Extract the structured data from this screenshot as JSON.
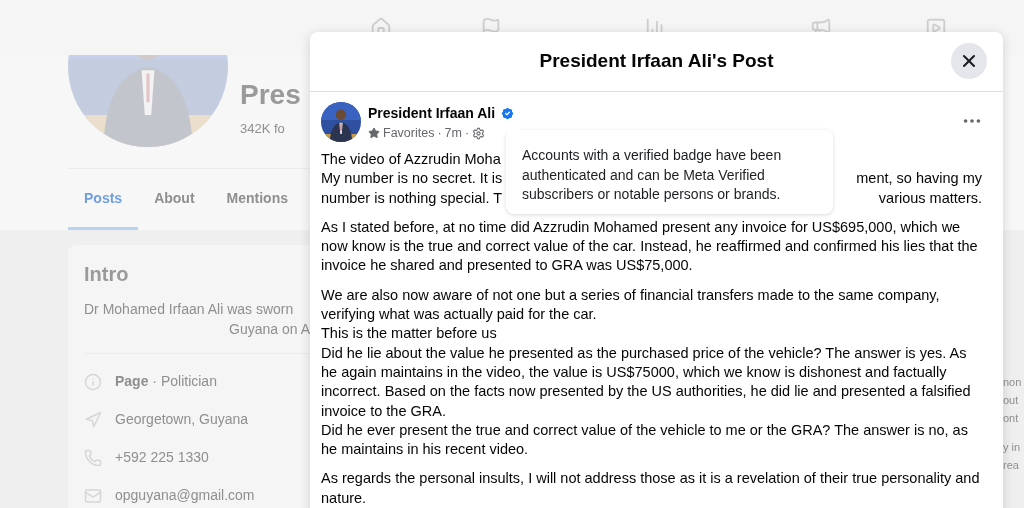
{
  "background_page": {
    "profile_name": "Pres",
    "followers": "342K fo",
    "tabs": [
      {
        "label": "Posts",
        "selected": true
      },
      {
        "label": "About",
        "selected": false
      },
      {
        "label": "Mentions",
        "selected": false
      }
    ],
    "intro": {
      "title": "Intro",
      "lines": [
        "Dr Mohamed Irfaan Ali was sworn",
        "Guyana on A"
      ],
      "items": [
        {
          "kind": "info",
          "text": "**Page** · Politician"
        },
        {
          "kind": "location",
          "text": "Georgetown, Guyana"
        },
        {
          "kind": "phone",
          "text": "+592 225 1330"
        },
        {
          "kind": "email",
          "text": "opguyana@gmail.com"
        }
      ]
    },
    "right_fragments": [
      "non",
      "out",
      "ont",
      "y in",
      "rea"
    ]
  },
  "dialog": {
    "title": "President Irfaan Ali's Post",
    "post": {
      "author": "President Irfaan Ali",
      "verified": true,
      "audience": "Favorites",
      "time": "7m",
      "separators": [
        "·",
        "·"
      ],
      "first_paragraph_lines": [
        {
          "left": "The video of Azzrudin Moha"
        },
        {
          "left": "My number is no secret. It is",
          "right": "ment, so having my"
        },
        {
          "left": "number is nothing special. T",
          "right": "various matters."
        }
      ],
      "paragraphs": [
        [
          "As I stated before, at no time did Azzrudin Mohamed present any invoice for US$695,000, which we now know is the true and correct value of the car. Instead, he reaffirmed and confirmed his lies that the invoice he shared and presented to GRA was US$75,000."
        ],
        [
          "We are also now aware of not one but a series of financial transfers made to the same company, verifying what was actually paid for the car.",
          "This is the matter before us",
          "Did he lie about the value he presented as the purchased price of the vehicle? The answer is yes. As he again maintains in the video, the value is US$75000, which we know is dishonest and factually incorrect. Based on the facts now presented by the US authorities, he did lie and presented a falsified invoice to the GRA.",
          "Did he ever present the true and correct value of the vehicle to me or the GRA? The answer is no, as he maintains in his recent video."
        ],
        [
          "As regards the personal insults, I will not address those as it is a revelation of their true personality and nature."
        ]
      ]
    },
    "tooltip": "Accounts with a verified badge have been authenticated and can be Meta Verified subscribers or notable persons or brands."
  }
}
